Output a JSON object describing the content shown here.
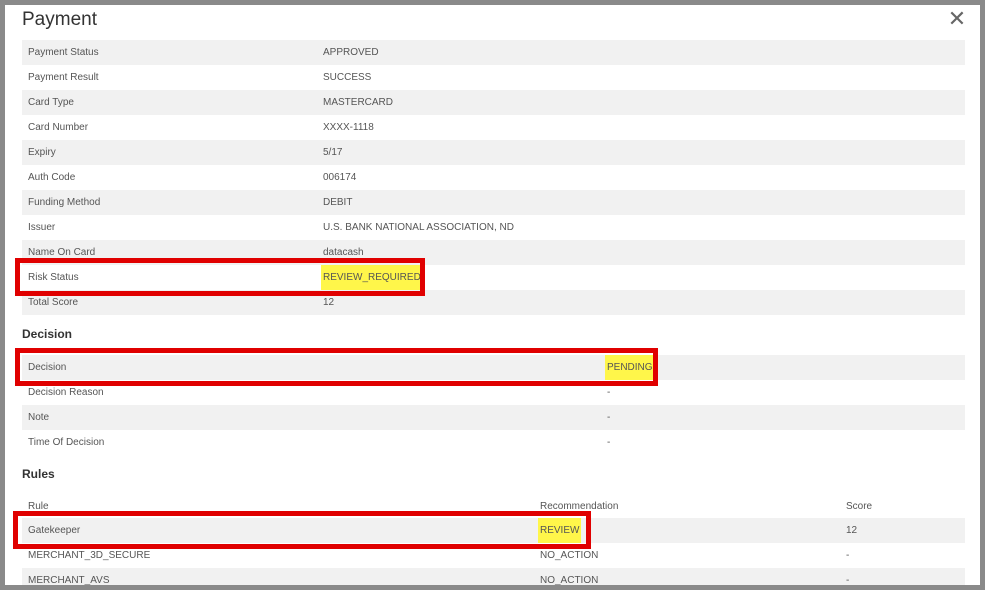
{
  "dialog": {
    "title": "Payment",
    "close_icon": "close-icon"
  },
  "payment": [
    {
      "label": "Payment Status",
      "value": "APPROVED"
    },
    {
      "label": "Payment Result",
      "value": "SUCCESS"
    },
    {
      "label": "Card Type",
      "value": "MASTERCARD"
    },
    {
      "label": "Card Number",
      "value": "XXXX-1118"
    },
    {
      "label": "Expiry",
      "value": "5/17"
    },
    {
      "label": "Auth Code",
      "value": "006174"
    },
    {
      "label": "Funding Method",
      "value": "DEBIT"
    },
    {
      "label": "Issuer",
      "value": "U.S. BANK NATIONAL ASSOCIATION, ND"
    },
    {
      "label": "Name On Card",
      "value": "datacash"
    },
    {
      "label": "Risk Status",
      "value": "REVIEW_REQUIRED"
    },
    {
      "label": "Total Score",
      "value": "12"
    }
  ],
  "decision": {
    "heading": "Decision",
    "rows": [
      {
        "label": "Decision",
        "value": "PENDING"
      },
      {
        "label": "Decision Reason",
        "value": "-"
      },
      {
        "label": "Note",
        "value": "-"
      },
      {
        "label": "Time Of Decision",
        "value": "-"
      }
    ]
  },
  "rules": {
    "heading": "Rules",
    "columns": {
      "rule": "Rule",
      "recommendation": "Recommendation",
      "score": "Score"
    },
    "rows": [
      {
        "rule": "Gatekeeper",
        "recommendation": "REVIEW",
        "score": "12"
      },
      {
        "rule": "MERCHANT_3D_SECURE",
        "recommendation": "NO_ACTION",
        "score": "-"
      },
      {
        "rule": "MERCHANT_AVS",
        "recommendation": "NO_ACTION",
        "score": "-"
      }
    ]
  },
  "highlight_color": "#fff64a",
  "annotation_color": "#e00000"
}
